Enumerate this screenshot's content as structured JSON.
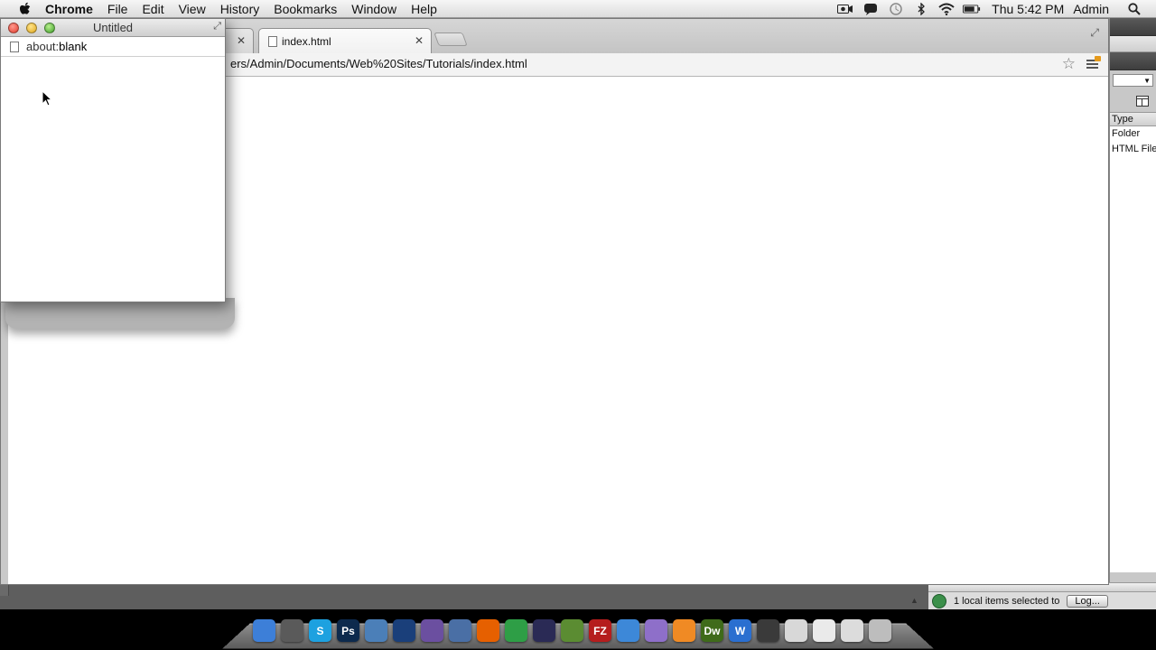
{
  "menubar": {
    "app_name": "Chrome",
    "items": [
      "File",
      "Edit",
      "View",
      "History",
      "Bookmarks",
      "Window",
      "Help"
    ],
    "clock": "Thu 5:42 PM",
    "user": "Admin",
    "status_icons": [
      "camera-icon",
      "chat-icon",
      "time-machine-icon",
      "bluetooth-icon",
      "wifi-icon",
      "battery-icon"
    ]
  },
  "main_window": {
    "tabs": [
      {
        "label": "",
        "active": false
      },
      {
        "label": "index.html",
        "active": true
      }
    ],
    "address": "ers/Admin/Documents/Web%20Sites/Tutorials/index.html"
  },
  "popup_window": {
    "title": "Untitled",
    "address_scheme": "about:",
    "address_host": "blank"
  },
  "dreamweaver": {
    "files_header": "Type",
    "rows": [
      "Folder",
      "HTML File"
    ],
    "status_text": "1 local items selected to",
    "log_button": "Log..."
  },
  "dock": {
    "icons": [
      {
        "name": "finder-icon",
        "label": "",
        "color": "#3d7fd8"
      },
      {
        "name": "utilities-icon",
        "label": "",
        "color": "#5a5a5a"
      },
      {
        "name": "skype-icon",
        "label": "S",
        "color": "#1da1e0"
      },
      {
        "name": "photoshop-icon",
        "label": "Ps",
        "color": "#0d2a4d"
      },
      {
        "name": "preview-icon",
        "label": "",
        "color": "#4b7fb8"
      },
      {
        "name": "quicktime-icon",
        "label": "",
        "color": "#1a3f7a"
      },
      {
        "name": "feather-icon",
        "label": "",
        "color": "#6b4fa0"
      },
      {
        "name": "xcode-icon",
        "label": "",
        "color": "#4a6fa5"
      },
      {
        "name": "firefox-icon",
        "label": "",
        "color": "#e66000"
      },
      {
        "name": "chrome-icon",
        "label": "",
        "color": "#2e9e46"
      },
      {
        "name": "imovie-icon",
        "label": "",
        "color": "#2a2a55"
      },
      {
        "name": "minecraft-icon",
        "label": "",
        "color": "#5b8c32"
      },
      {
        "name": "filezilla-icon",
        "label": "FZ",
        "color": "#b51d1d"
      },
      {
        "name": "app-store-icon",
        "label": "",
        "color": "#3d88d8"
      },
      {
        "name": "itunes-icon",
        "label": "",
        "color": "#8e6fc9"
      },
      {
        "name": "xampp-icon",
        "label": "",
        "color": "#f08a24"
      },
      {
        "name": "dreamweaver-icon",
        "label": "Dw",
        "color": "#3f6b1a"
      },
      {
        "name": "word-icon",
        "label": "W",
        "color": "#2a6fd0"
      },
      {
        "name": "photo-booth-icon",
        "label": "",
        "color": "#3a3a3a"
      },
      {
        "name": "mail-icon",
        "label": "",
        "color": "#d8d8d8"
      },
      {
        "name": "document-icon",
        "label": "",
        "color": "#eaeaea"
      },
      {
        "name": "downloads-icon",
        "label": "",
        "color": "#dcdcdc"
      },
      {
        "name": "trash-icon",
        "label": "",
        "color": "#bdbdbd"
      }
    ]
  }
}
